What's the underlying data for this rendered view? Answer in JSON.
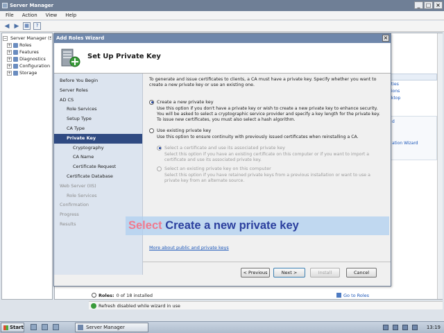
{
  "server_manager": {
    "title": "Server Manager",
    "window_controls": [
      "_",
      "□",
      "×"
    ],
    "menu": [
      "File",
      "Action",
      "View",
      "Help"
    ],
    "tree": {
      "root": "Server Manager (S",
      "items": [
        "Roles",
        "Features",
        "Diagnostics",
        "Configuration",
        "Storage"
      ]
    },
    "right_links": [
      "ties",
      "ions",
      "ktop"
    ],
    "right_lower_links": [
      "d",
      "ation Wizard"
    ],
    "roles_label": "Roles:",
    "roles_status": "0 of 18 installed",
    "goto_roles": "Go to Roles",
    "status_text": "Refresh disabled while wizard in use"
  },
  "wizard": {
    "title": "Add Roles Wizard",
    "close": "×",
    "heading": "Set Up Private Key",
    "nav": [
      {
        "label": "Before You Begin",
        "level": 0,
        "state": "normal"
      },
      {
        "label": "Server Roles",
        "level": 0,
        "state": "normal"
      },
      {
        "label": "AD CS",
        "level": 0,
        "state": "normal"
      },
      {
        "label": "Role Services",
        "level": 1,
        "state": "normal"
      },
      {
        "label": "Setup Type",
        "level": 1,
        "state": "normal"
      },
      {
        "label": "CA Type",
        "level": 1,
        "state": "normal"
      },
      {
        "label": "Private Key",
        "level": 1,
        "state": "active"
      },
      {
        "label": "Cryptography",
        "level": 2,
        "state": "normal"
      },
      {
        "label": "CA Name",
        "level": 2,
        "state": "normal"
      },
      {
        "label": "Certificate Request",
        "level": 2,
        "state": "normal"
      },
      {
        "label": "Certificate Database",
        "level": 1,
        "state": "normal"
      },
      {
        "label": "Web Server (IIS)",
        "level": 0,
        "state": "dim"
      },
      {
        "label": "Role Services",
        "level": 1,
        "state": "dim"
      },
      {
        "label": "Confirmation",
        "level": 0,
        "state": "dim"
      },
      {
        "label": "Progress",
        "level": 0,
        "state": "dim"
      },
      {
        "label": "Results",
        "level": 0,
        "state": "dim"
      }
    ],
    "intro": "To generate and issue certificates to clients, a CA must have a private key. Specify whether you want to create a new private key or use an existing one.",
    "option_new": {
      "label": "Create a new private key",
      "selected": true,
      "desc": "Use this option if you don't have a private key or wish to create a new private key to enhance security. You will be asked to select a cryptographic service provider and specify a key length for the private key. To issue new certificates, you must also select a hash algorithm."
    },
    "option_existing": {
      "label": "Use existing private key",
      "selected": false,
      "desc": "Use this option to ensure continuity with previously issued certificates when reinstalling a CA."
    },
    "sub_option_cert": {
      "label": "Select a certificate and use its associated private key",
      "desc": "Select this option if you have an existing certificate on this computer or if you want to import a certificate and use its associated private key."
    },
    "sub_option_key": {
      "label": "Select an existing private key on this computer",
      "desc": "Select this option if you have retained private keys from a previous installation or want to use a private key from an alternate source."
    },
    "more_link": "More about public and private keys",
    "buttons": {
      "previous": "< Previous",
      "next": "Next >",
      "install": "Install",
      "cancel": "Cancel"
    }
  },
  "caption": {
    "keyword": "Select",
    "text": "Create a new private key"
  },
  "taskbar": {
    "start": "Start",
    "task": "Server Manager",
    "clock": "13:19"
  },
  "colors": {
    "accent": "#2f4a82",
    "caption_keyword": "#f07a8e",
    "caption_text": "#2b3f9e",
    "link": "#1a55b8"
  }
}
